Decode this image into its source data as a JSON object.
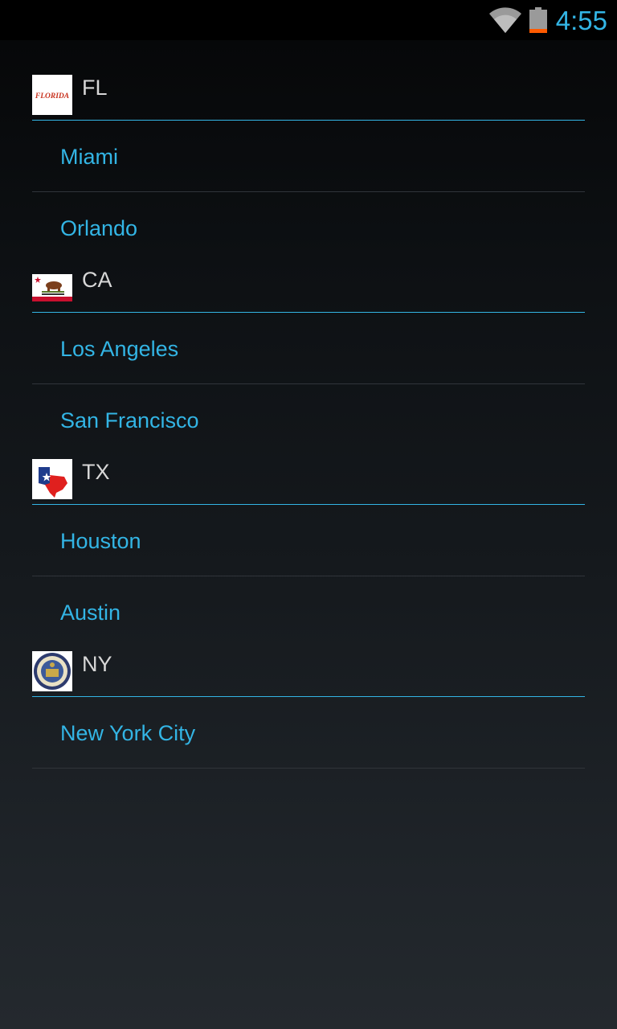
{
  "status_bar": {
    "time": "4:55",
    "icons": [
      "wifi-icon",
      "battery-icon"
    ],
    "accent_color": "#33b5e5"
  },
  "sections": [
    {
      "state": "FL",
      "flag_icon": "florida-flag-icon",
      "flag_text": "FLORIDA",
      "cities": [
        "Miami",
        "Orlando"
      ]
    },
    {
      "state": "CA",
      "flag_icon": "california-flag-icon",
      "cities": [
        "Los Angeles",
        "San Francisco"
      ]
    },
    {
      "state": "TX",
      "flag_icon": "texas-map-flag-icon",
      "cities": [
        "Houston",
        "Austin"
      ]
    },
    {
      "state": "NY",
      "flag_icon": "new-york-seal-icon",
      "cities": [
        "New York City"
      ]
    }
  ],
  "colors": {
    "header_text": "#d7d7d7",
    "city_text": "#33b5e5",
    "header_divider": "#33b5e5",
    "row_divider": "#30343a"
  }
}
